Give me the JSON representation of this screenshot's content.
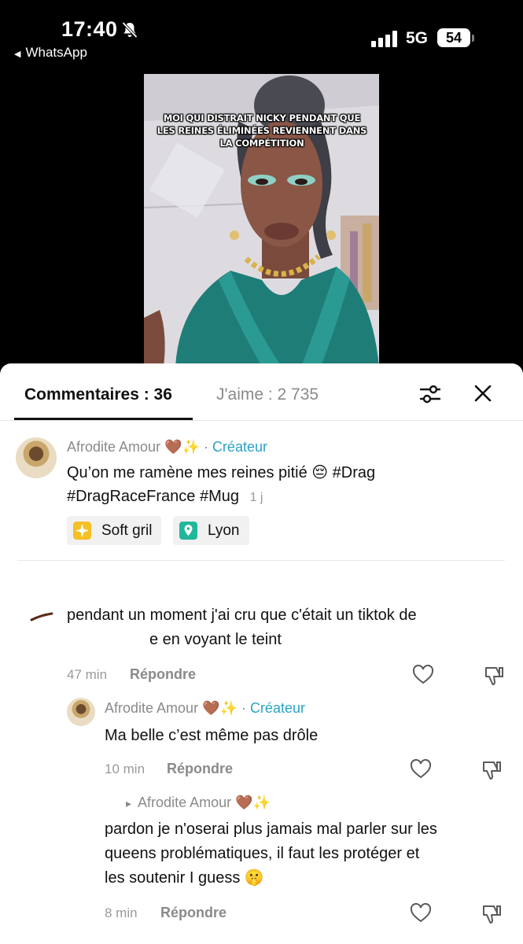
{
  "status_bar": {
    "time": "17:40",
    "back_label": "WhatsApp",
    "network": "5G",
    "battery": "54"
  },
  "video": {
    "caption": "Moi qui distrait Nicky pendant que les reines éliminées reviennent dans la compétition"
  },
  "tabs": {
    "comments": "Commentaires : 36",
    "likes": "J'aime : 2 735"
  },
  "post": {
    "author": "Afrodite Amour",
    "author_emoji": "🤎✨",
    "separator": "·",
    "creator_badge": "Créateur",
    "line1": "Qu’on me ramène mes reines pitié 😔 #Drag",
    "line2": "#DragRaceFrance #Mug",
    "time": "1 j",
    "chips": [
      {
        "label": "Soft gril",
        "icon": "sparkle-icon",
        "color": "#f5c023"
      },
      {
        "label": "Lyon",
        "icon": "location-pin-icon",
        "color": "#1fb89a"
      }
    ]
  },
  "comments": [
    {
      "line1": "pendant un moment j'ai cru que c'était un tiktok de",
      "line2": "e en voyant le teint",
      "time": "47 min",
      "reply": "Répondre"
    },
    {
      "author": "Afrodite Amour",
      "author_emoji": "🤎✨",
      "separator": "·",
      "creator_badge": "Créateur",
      "text": "Ma belle c’est même pas drôle",
      "time": "10 min",
      "reply": "Répondre"
    },
    {
      "reply_arrow": "▸",
      "reply_to": "Afrodite Amour",
      "reply_to_emoji": "🤎✨",
      "line1": "pardon je n'oserai plus jamais mal parler sur les",
      "line2": "queens problématiques, il faut les protéger et",
      "line3": "les soutenir I guess 🤫",
      "time": "8 min",
      "reply": "Répondre"
    }
  ],
  "colors": {
    "accent_creator": "#2aa3c6",
    "muted": "#8a8a8a",
    "text": "#111111"
  }
}
